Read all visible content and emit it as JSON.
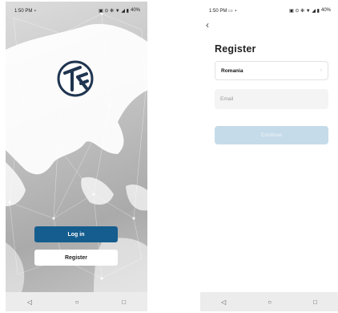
{
  "left_screen": {
    "status": {
      "time": "1:50 PM",
      "left_icon": "⋆",
      "right_icons": "▣ ⊙ ✻ ▼ ◢ ▮",
      "battery": "40%"
    },
    "login_label": "Log in",
    "register_label": "Register",
    "nav": {
      "back": "◁",
      "home": "○",
      "recents": "□"
    }
  },
  "right_screen": {
    "status": {
      "time": "1:50 PM",
      "left_icon": "▭ ⋆",
      "right_icons": "▣ ⊙ ✻ ▼ ◢ ▮",
      "battery": "40%"
    },
    "back_icon": "‹",
    "title": "Register",
    "country_value": "Romania",
    "country_chevron": "›",
    "email_placeholder": "Email",
    "continue_label": "Continue",
    "nav": {
      "back": "◁",
      "home": "○",
      "recents": "□"
    }
  },
  "colors": {
    "primary": "#155d8e",
    "continue_disabled": "#c5dbe9"
  }
}
